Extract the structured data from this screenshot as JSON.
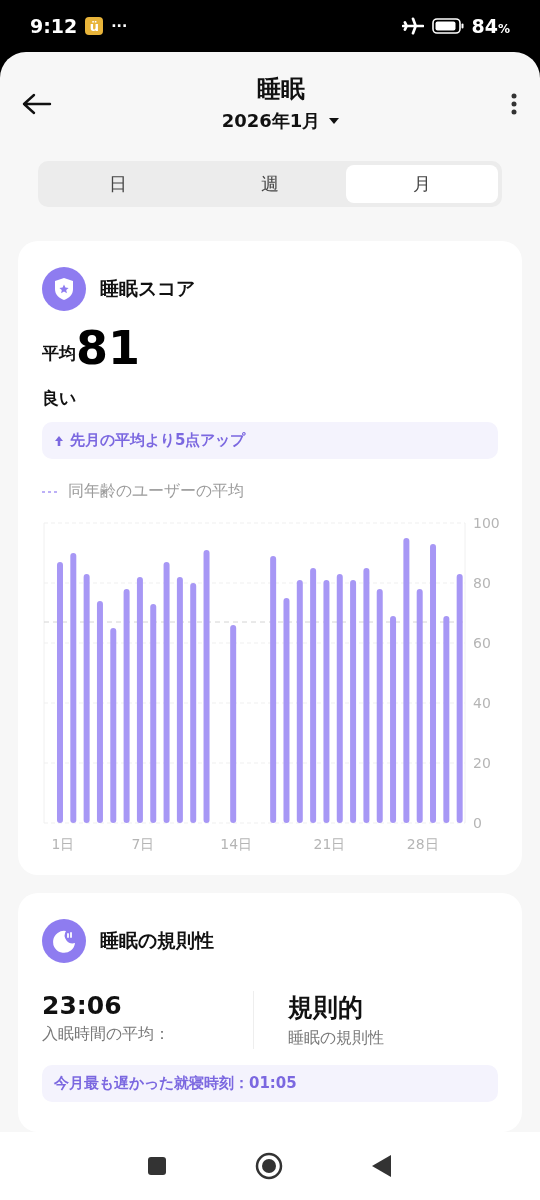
{
  "status_bar": {
    "time": "9:12",
    "app_badge": "ü",
    "more": "···",
    "battery": "84",
    "battery_unit": "%"
  },
  "header": {
    "title": "睡眠",
    "period": "2026年1月"
  },
  "tabs": [
    {
      "label": "日",
      "selected": false
    },
    {
      "label": "週",
      "selected": false
    },
    {
      "label": "月",
      "selected": true
    }
  ],
  "score_card": {
    "title": "睡眠スコア",
    "average_label": "平均",
    "average": "81",
    "rating": "良い",
    "comparison": "先月の平均より5点アップ",
    "chart_data": {
      "type": "bar",
      "x": [
        1,
        2,
        3,
        4,
        5,
        6,
        7,
        8,
        9,
        10,
        11,
        12,
        13,
        14,
        15,
        16,
        17,
        18,
        19,
        20,
        21,
        22,
        23,
        24,
        25,
        26,
        27,
        28,
        29,
        30,
        31
      ],
      "series": [
        {
          "color": "#a797f5",
          "values": [
            87,
            90,
            83,
            74,
            65,
            78,
            82,
            73,
            87,
            82,
            80,
            91,
            null,
            66,
            null,
            null,
            89,
            75,
            81,
            85,
            81,
            83,
            81,
            85,
            78,
            69,
            95,
            78,
            93,
            69,
            83
          ]
        }
      ],
      "xlim": [
        -0.2,
        31.4
      ],
      "ylim": [
        0,
        100
      ],
      "grid": true,
      "yticks": [
        0,
        20,
        40,
        60,
        80,
        100
      ],
      "xticks": [
        {
          "value": 1,
          "label": "1日"
        },
        {
          "value": 7,
          "label": "7日"
        },
        {
          "value": 14,
          "label": "14日"
        },
        {
          "value": 21,
          "label": "21日"
        },
        {
          "value": 28,
          "label": "28日"
        }
      ],
      "ref_lines": [
        {
          "axis": "y",
          "value": 67,
          "label": "同年齢のユーザーの平均"
        }
      ]
    }
  },
  "regularity_card": {
    "title": "睡眠の規則性",
    "bedtime": "23:06",
    "bedtime_label": "入眠時間の平均：",
    "status": "規則的",
    "status_label": "睡眠の規則性",
    "latest": "今月最も遅かった就寝時刻：01:05"
  }
}
